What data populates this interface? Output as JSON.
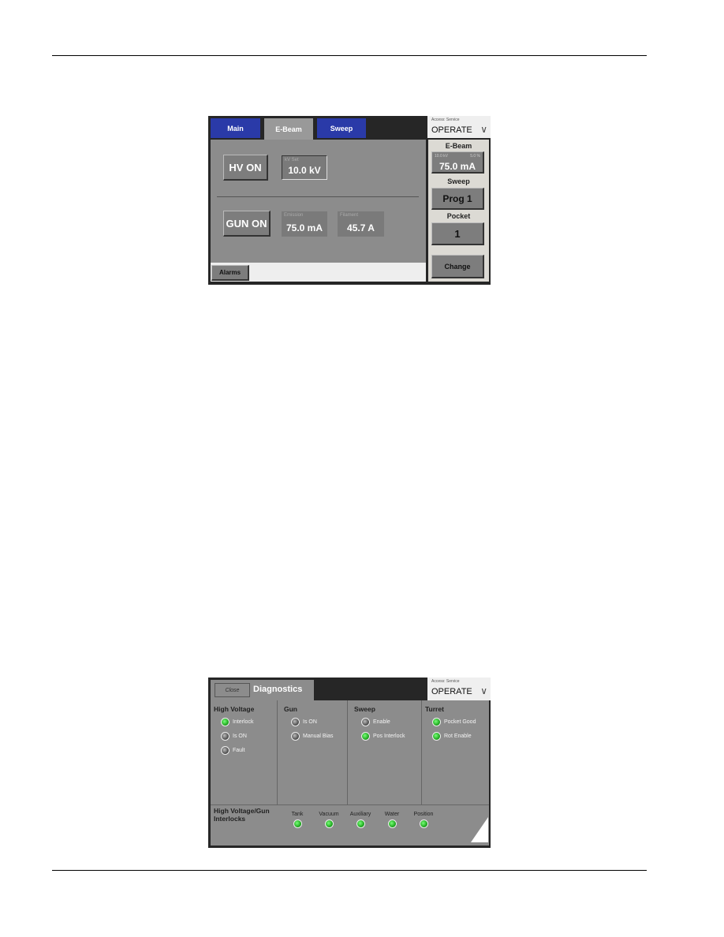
{
  "ebeam_screen": {
    "tabs": [
      {
        "label": "Main",
        "active": false
      },
      {
        "label": "E-Beam",
        "active": true
      },
      {
        "label": "Sweep",
        "active": false
      }
    ],
    "access": {
      "label": "Access: Service",
      "mode": "OPERATE"
    },
    "hv_button": "HV ON",
    "kv_set": {
      "label": "kV Set",
      "value": "10.0 kV"
    },
    "gun_button": "GUN ON",
    "emission": {
      "label": "Emission",
      "value": "75.0 mA"
    },
    "filament": {
      "label": "Filament",
      "value": "45.7 A"
    },
    "alarms_button": "Alarms",
    "side": {
      "ebeam_label": "E-Beam",
      "ebeam_kv": "10.0 kV",
      "ebeam_pct": "5.0 %",
      "ebeam_value": "75.0 mA",
      "sweep_label": "Sweep",
      "sweep_value": "Prog 1",
      "pocket_label": "Pocket",
      "pocket_value": "1",
      "change_button": "Change"
    }
  },
  "diag_screen": {
    "close_button": "Close",
    "title": "Diagnostics",
    "access": {
      "label": "Access: Service",
      "mode": "OPERATE"
    },
    "groups": [
      {
        "title": "High Voltage",
        "items": [
          {
            "label": "Interlock",
            "on": true
          },
          {
            "label": "Is ON",
            "on": false
          },
          {
            "label": "Fault",
            "on": false
          }
        ]
      },
      {
        "title": "Gun",
        "items": [
          {
            "label": "Is ON",
            "on": false
          },
          {
            "label": "Manual Bias",
            "on": false
          }
        ]
      },
      {
        "title": "Sweep",
        "items": [
          {
            "label": "Enable",
            "on": false
          },
          {
            "label": "Pos Interlock",
            "on": true
          }
        ]
      },
      {
        "title": "Turret",
        "items": [
          {
            "label": "Pocket Good",
            "on": true
          },
          {
            "label": "Rot Enable",
            "on": true
          }
        ]
      }
    ],
    "interlocks": {
      "title1": "High Voltage/Gun",
      "title2": "Interlocks",
      "items": [
        {
          "label": "Tank",
          "on": true
        },
        {
          "label": "Vacuum",
          "on": true
        },
        {
          "label": "Auxiliary",
          "on": true
        },
        {
          "label": "Water",
          "on": true
        },
        {
          "label": "Position",
          "on": true
        }
      ]
    }
  }
}
